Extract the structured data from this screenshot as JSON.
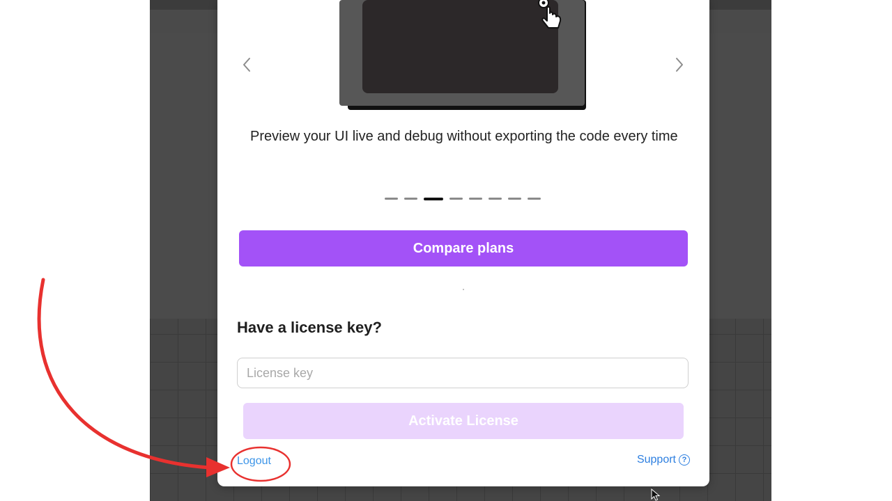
{
  "carousel": {
    "prev_icon": "chevron-left-icon",
    "next_icon": "chevron-right-icon",
    "caption": "Preview your UI live and debug without exporting the code every time",
    "slide_count": 8,
    "active_index": 2
  },
  "plans": {
    "compare_label": "Compare plans"
  },
  "license": {
    "heading": "Have a license key?",
    "placeholder": "License key",
    "value": "",
    "activate_label": "Activate License"
  },
  "footer": {
    "logout_label": "Logout",
    "support_label": "Support",
    "support_icon": "help-circle-icon"
  },
  "colors": {
    "accent": "#a352f7",
    "accent_disabled": "#ead4fd",
    "link": "#3d95e8",
    "annotation": "#e8312f",
    "backdrop": "#454545"
  }
}
